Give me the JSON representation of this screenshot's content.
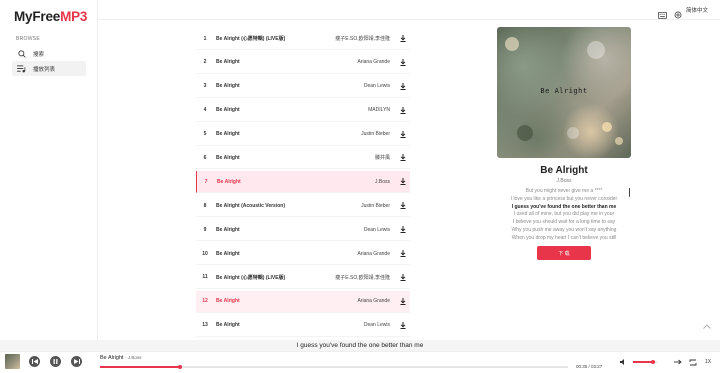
{
  "app": {
    "logo_part1": "MyFree",
    "logo_part2": "MP3"
  },
  "sidebar": {
    "section_label": "BROWSE",
    "items": [
      {
        "label": "搜索",
        "icon": "search-icon"
      },
      {
        "label": "播放列表",
        "icon": "playlist-icon"
      }
    ]
  },
  "topbar": {
    "language": "简体中文",
    "icons": [
      "keyboard-icon",
      "settings-icon"
    ]
  },
  "songs": [
    {
      "num": "1",
      "title": "Be Alright (心愿特輯) (LIVE版)",
      "artist": "瘦子E.SO,欧阳靖,李佳隆"
    },
    {
      "num": "2",
      "title": "Be Alright",
      "artist": "Ariana Grande"
    },
    {
      "num": "3",
      "title": "Be Alright",
      "artist": "Dean Lewis"
    },
    {
      "num": "4",
      "title": "Be Alright",
      "artist": "MADILYN"
    },
    {
      "num": "5",
      "title": "Be Alright",
      "artist": "Justin Bieber"
    },
    {
      "num": "6",
      "title": "Be Alright",
      "artist": "滕井風"
    },
    {
      "num": "7",
      "title": "Be Alright",
      "artist": "J.Boss"
    },
    {
      "num": "8",
      "title": "Be Alright (Acoustic Version)",
      "artist": "Justin Bieber"
    },
    {
      "num": "9",
      "title": "Be Alright",
      "artist": "Dean Lewis"
    },
    {
      "num": "10",
      "title": "Be Alright",
      "artist": "Ariana Grande"
    },
    {
      "num": "11",
      "title": "Be Alright (心愿特輯) (LIVE版)",
      "artist": "瘦子E.SO,欧阳靖,李佳隆"
    },
    {
      "num": "12",
      "title": "Be Alright",
      "artist": "Ariana Grande"
    },
    {
      "num": "13",
      "title": "Be Alright",
      "artist": "Dean Lewis"
    }
  ],
  "now_playing": {
    "cover_text": "Be Alright",
    "title": "Be Alright",
    "artist": "J.Boss",
    "lyrics": [
      "But you might never give me a ****",
      "I love you like a princess but you never consider",
      "I guess you've found the one better than me",
      "I used all of mine, but you did play me in your",
      "I believe you should wait for a long time to say",
      "Why you push me away you won't say anything",
      "When you drop my heart I can't believe you still"
    ],
    "current_lyric_index": 2,
    "download_label": "下 载"
  },
  "caption": "I guess you've found the one better than me",
  "player": {
    "title": "Be Alright",
    "artist": "- J.Boss",
    "time": "00:35 / 03:27",
    "progress": 0.17,
    "volume": 0.85,
    "speed": "1X"
  },
  "colors": {
    "accent": "#e8354a",
    "active_row_bg": "#ffe9ee"
  }
}
